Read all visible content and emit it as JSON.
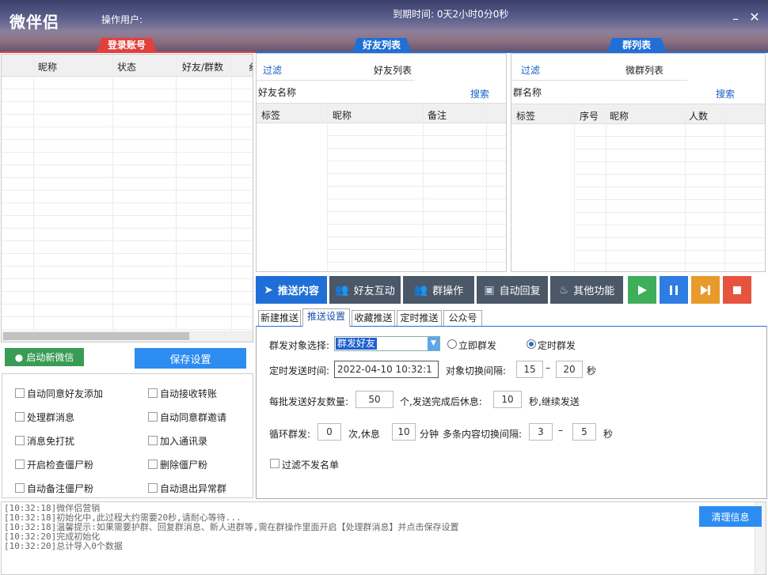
{
  "app": {
    "title": "微伴侣",
    "operator_label": "操作用户:",
    "expire_text": "到期时间: 0天2小时0分0秒",
    "minimize": "–",
    "close": "✕"
  },
  "sections": {
    "login": "登录账号",
    "friends": "好友列表",
    "groups": "群列表"
  },
  "account_grid": {
    "columns": [
      "昵称",
      "状态",
      "好友/群数",
      "纟"
    ]
  },
  "friends": {
    "filter": "过滤",
    "list_label": "好友列表",
    "name_label": "好友名称",
    "search": "搜索",
    "columns": [
      "标签",
      "昵称",
      "备注"
    ]
  },
  "groups": {
    "filter": "过滤",
    "list_label": "微群列表",
    "name_label": "群名称",
    "search": "搜索",
    "columns": [
      "标签",
      "序号",
      "昵称",
      "人数"
    ]
  },
  "left_buttons": {
    "start": "启动新微信",
    "save": "保存设置"
  },
  "options": [
    {
      "label": "自动同意好友添加",
      "checked": false
    },
    {
      "label": "自动接收转账",
      "checked": false
    },
    {
      "label": "处理群消息",
      "checked": false
    },
    {
      "label": "自动同意群邀请",
      "checked": false
    },
    {
      "label": "消息免打扰",
      "checked": false
    },
    {
      "label": "加入通讯录",
      "checked": false
    },
    {
      "label": "开启检查僵尸粉",
      "checked": false
    },
    {
      "label": "删除僵尸粉",
      "checked": false
    },
    {
      "label": "自动备注僵尸粉",
      "checked": false
    },
    {
      "label": "自动退出异常群",
      "checked": false
    }
  ],
  "toolbar": {
    "push": "推送内容",
    "friend": "好友互动",
    "group": "群操作",
    "reply": "自动回复",
    "other": "其他功能"
  },
  "colors": {
    "play": "#3fae5a",
    "pause": "#2d7de3",
    "next": "#e89b2a",
    "stop": "#e6533e",
    "primary": "#1f6fd6"
  },
  "subtabs": [
    "新建推送",
    "推送设置",
    "收藏推送",
    "定时推送",
    "公众号"
  ],
  "push": {
    "target_label": "群发对象选择:",
    "target_value": "群发好友",
    "instant_label": "立即群发",
    "timed_label": "定时群发",
    "timed_selected": true,
    "time_label": "定时发送时间:",
    "time_value": "2022-04-10 10:32:1",
    "switch_label": "对象切换间隔:",
    "switch_min": "15",
    "switch_dash": "–",
    "switch_max": "20",
    "sec": "秒",
    "batch_label": "每批发送好友数量:",
    "batch_value": "50",
    "batch_unit": "个,发送完成后休息:",
    "rest_value": "10",
    "rest_unit": "秒,继续发送",
    "loop_label": "循环群发:",
    "loop_value": "0",
    "loop_unit": "次,休息",
    "loop_rest": "10",
    "loop_rest_unit": "分钟",
    "multi_label": "多条内容切换间隔:",
    "multi_min": "3",
    "multi_dash": "–",
    "multi_max": "5",
    "multi_unit": "秒",
    "filter_label": "过滤不发名单"
  },
  "log": {
    "clear": "清理信息",
    "lines": [
      "[10:32:18]微伴侣营销",
      "[10:32:18]初始化中,此过程大约需要20秒,请耐心等待...",
      "[10:32:18]温馨提示:如果需要护群、回复群消息、新人进群等,需在群操作里面开启【处理群消息】并点击保存设置",
      "[10:32:20]完成初始化",
      "[10:32:20]总计导入0个数据"
    ]
  }
}
